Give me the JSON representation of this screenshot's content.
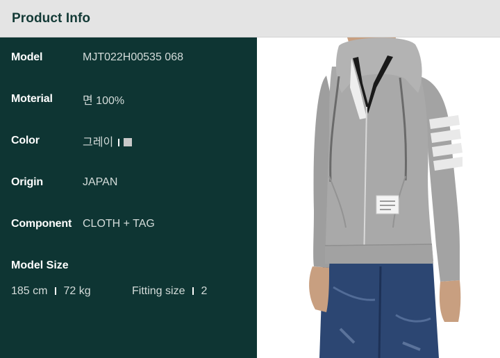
{
  "header": {
    "title": "Product Info"
  },
  "info": {
    "model": {
      "label": "Model",
      "value": "MJT022H00535 068"
    },
    "material": {
      "label": "Moterial",
      "value": "면 100%"
    },
    "color": {
      "label": "Color",
      "value": "그레이",
      "swatch": "#c9c9c9"
    },
    "origin": {
      "label": "Origin",
      "value": "JAPAN"
    },
    "component": {
      "label": "Component",
      "value": "CLOTH + TAG"
    }
  },
  "model_size": {
    "title": "Model Size",
    "height": "185 cm",
    "weight": "72 kg",
    "fitting_label": "Fitting size",
    "fitting_value": "2"
  },
  "colors": {
    "header_bg": "#e4e4e4",
    "header_text": "#133a36",
    "panel_bg": "#0e3533",
    "garment": "#a9a9a9"
  }
}
